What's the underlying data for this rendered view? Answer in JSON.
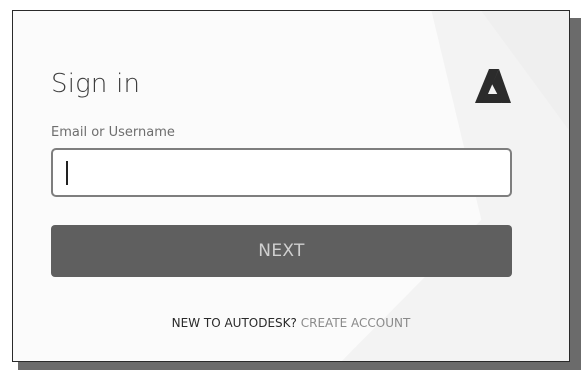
{
  "signin": {
    "title": "Sign in",
    "email_label": "Email or Username",
    "email_value": "",
    "next_label": "NEXT",
    "footer_prompt": "NEW TO AUTODESK?",
    "create_account_link": "CREATE ACCOUNT",
    "logo_icon": "autodesk-logo-icon"
  },
  "colors": {
    "card_background": "#fbfbfb",
    "button_background": "#5f5f5f",
    "button_text": "#cfcfcf",
    "input_border": "#7e7e7e",
    "link_text": "#8a8a8a",
    "title_text": "#3c3c3c"
  }
}
